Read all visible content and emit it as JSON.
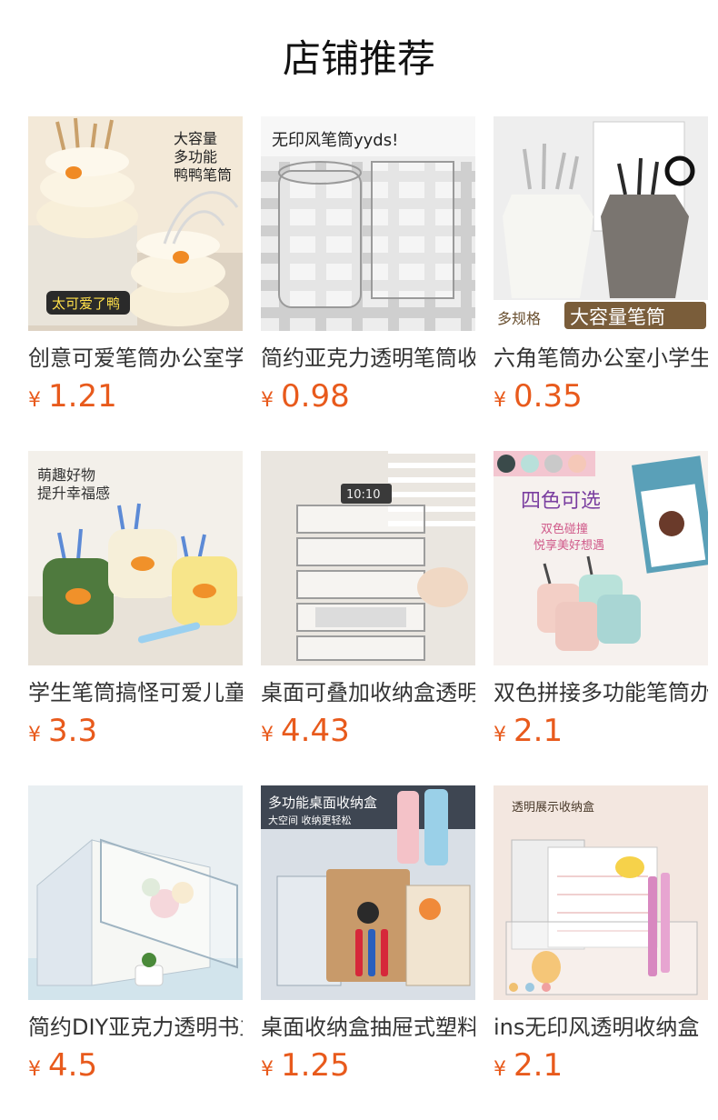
{
  "page": {
    "title": "店铺推荐"
  },
  "currency_symbol": "¥",
  "colors": {
    "price": "#e85a1c",
    "title": "#111111",
    "name": "#333333"
  },
  "products": [
    {
      "name": "创意可爱笔筒办公室学生桌面收纳",
      "price": "1.21",
      "image": {
        "icon": "duck-pen-holder",
        "texts": [
          "大容量",
          "多功能",
          "鸭鸭笔筒",
          "太可爱了鸭"
        ]
      }
    },
    {
      "name": "简约亚克力透明笔筒收纳盒",
      "price": "0.98",
      "image": {
        "icon": "acrylic-pen-holder",
        "texts": [
          "无印风笔筒yyds!"
        ]
      }
    },
    {
      "name": "六角笔筒办公室小学生大容量",
      "price": "0.35",
      "image": {
        "icon": "hexagon-pen-holder",
        "texts": [
          "多规格",
          "大容量笔筒"
        ]
      }
    },
    {
      "name": "学生笔筒搞怪可爱儿童桌面",
      "price": "3.3",
      "image": {
        "icon": "funny-face-pen-holder",
        "texts": [
          "萌趣好物",
          "提升幸福感"
        ]
      }
    },
    {
      "name": "桌面可叠加收纳盒透明文件",
      "price": "4.43",
      "image": {
        "icon": "stackable-drawer-box",
        "texts": [
          "10:10"
        ]
      }
    },
    {
      "name": "双色拼接多功能笔筒办公",
      "price": "2.1",
      "image": {
        "icon": "two-tone-pen-holder",
        "texts": [
          "四色可选",
          "双色碰撞",
          "悦享美好想遇"
        ]
      }
    },
    {
      "name": "简约DIY亚克力透明书立",
      "price": "4.5",
      "image": {
        "icon": "acrylic-book-stand",
        "texts": []
      }
    },
    {
      "name": "桌面收纳盒抽屉式塑料",
      "price": "1.25",
      "image": {
        "icon": "desktop-organizer",
        "texts": [
          "多功能桌面收纳盒",
          "大空间 收纳更轻松"
        ]
      }
    },
    {
      "name": "ins无印风透明收纳盒",
      "price": "2.1",
      "image": {
        "icon": "ins-clear-storage-box",
        "texts": [
          "透明展示收纳盒"
        ]
      }
    }
  ]
}
